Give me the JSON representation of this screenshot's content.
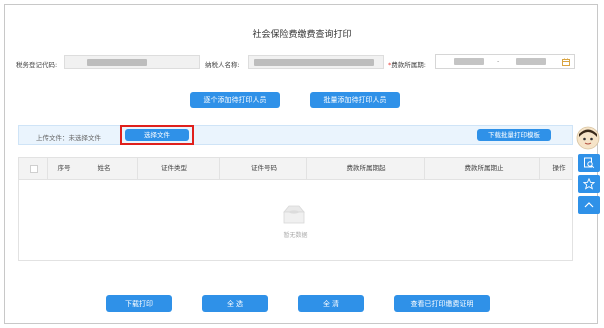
{
  "title": "社会保险费缴费查询打印",
  "form": {
    "tax_code_label": "税务登记代码:",
    "taxpayer_name_label": "纳税人名称:",
    "period_required_mark": "*",
    "period_label": "费款所属期:",
    "period_separator": "-"
  },
  "actions": {
    "add_one": "逐个添加待打印人员",
    "add_batch": "批量添加待打印人员"
  },
  "upload": {
    "label": "上传文件：未选择文件",
    "choose_file": "选择文件",
    "download_template": "下载批量打印模板"
  },
  "table": {
    "columns": [
      "序号",
      "姓名",
      "证件类型",
      "证件号码",
      "费款所属期起",
      "费款所属期止",
      "操作"
    ],
    "empty_text": "暂无数据"
  },
  "bottom": {
    "download_print": "下载打印",
    "select_all": "全 选",
    "clear_all": "全 清",
    "view_printed": "查看已打印缴费证明"
  },
  "colors": {
    "primary": "#2f91e8",
    "highlight_border": "#e0201c",
    "required": "#e53935"
  }
}
